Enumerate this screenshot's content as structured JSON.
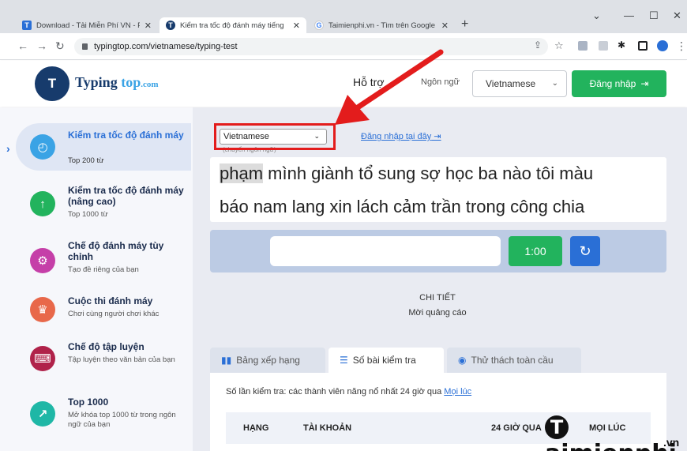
{
  "browser": {
    "tabs": [
      {
        "title": "Download - Tải Miễn Phí VN - Pi",
        "favicon": "T"
      },
      {
        "title": "Kiểm tra tốc độ đánh máy tiếng",
        "favicon": "T"
      },
      {
        "title": "Taimienphi.vn - Tìm trên Google",
        "favicon": "G"
      }
    ],
    "url": "typingtop.com/vietnamese/typing-test"
  },
  "header": {
    "logo_main": "Typing ",
    "logo_accent": "top",
    "logo_domain": ".com",
    "support": "Hỗ trợ",
    "language_label": "Ngôn ngữ",
    "language_value": "Vietnamese",
    "login_button": "Đăng nhập"
  },
  "sidebar": {
    "items": [
      {
        "title": "Kiểm tra tốc độ đánh máy",
        "subtitle": "Top 200 từ",
        "icon": "speedometer-icon",
        "color": "#3aa3e5"
      },
      {
        "title": "Kiểm tra tốc độ đánh máy (nâng cao)",
        "subtitle": "Top 1000 từ",
        "icon": "arrow-up-icon",
        "color": "#22b35d"
      },
      {
        "title": "Chế độ đánh máy tùy chỉnh",
        "subtitle": "Tạo đề riêng của bạn",
        "icon": "gear-icon",
        "color": "#c53fa8"
      },
      {
        "title": "Cuộc thi đánh máy",
        "subtitle": "Chơi cùng người chơi khác",
        "icon": "trophy-icon",
        "color": "#e8684a"
      },
      {
        "title": "Chế độ tập luyện",
        "subtitle": "Tập luyện theo văn bản của bạn",
        "icon": "keyboard-icon",
        "color": "#b0224a"
      },
      {
        "title": "Top 1000",
        "subtitle": "Mở khóa top 1000 từ trong ngôn ngữ của bạn",
        "icon": "chart-icon",
        "color": "#1fb7a6"
      }
    ]
  },
  "main": {
    "lang_select_value": "Vietnamese",
    "lang_select_hint": "(chuyển ngôn ngữ)",
    "login_here": "Đăng nhập tại đây",
    "words_line1_current": "phạm",
    "words_line1_rest": " mình giành tổ sung sợ học ba nào tôi màu",
    "words_line2": "báo nam lang xin lách cảm trần trong công chia",
    "timer": "1:00",
    "detail_title": "CHI TIẾT",
    "detail_sub": "Mời quảng cáo",
    "tabs": [
      {
        "label": "Bảng xếp hạng"
      },
      {
        "label": "Số bài kiểm tra"
      },
      {
        "label": "Thử thách toàn cầu"
      }
    ],
    "stats_text": "Số lần kiểm tra: các thành viên năng nổ nhất 24 giờ qua ",
    "stats_link": "Mọi lúc",
    "table_headers": [
      "HẠNG",
      "TÀI KHOẢN",
      "24 GIỜ QUA",
      "MỌI LÚC"
    ]
  },
  "watermark": {
    "letter": "T",
    "text": "aimienphi",
    "suffix": ".vn"
  }
}
